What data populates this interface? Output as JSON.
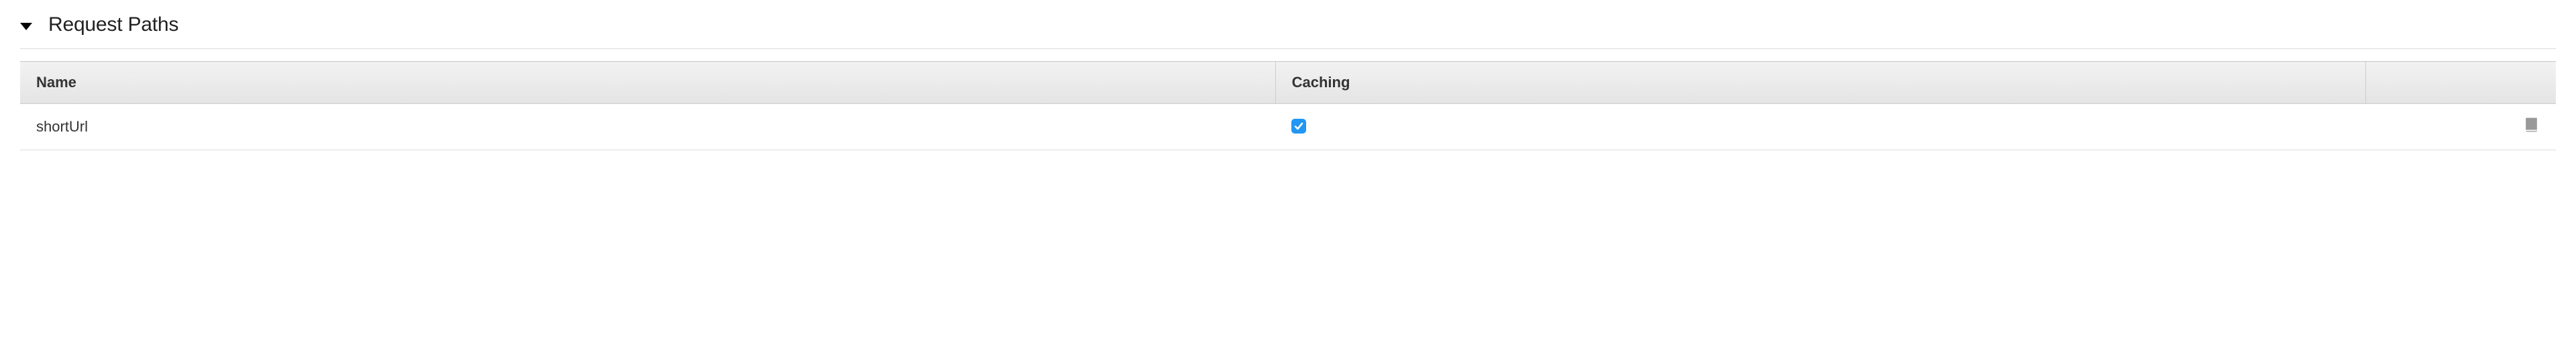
{
  "section": {
    "title": "Request Paths"
  },
  "table": {
    "headers": {
      "name": "Name",
      "caching": "Caching"
    },
    "rows": [
      {
        "name": "shortUrl",
        "caching": true
      }
    ]
  }
}
